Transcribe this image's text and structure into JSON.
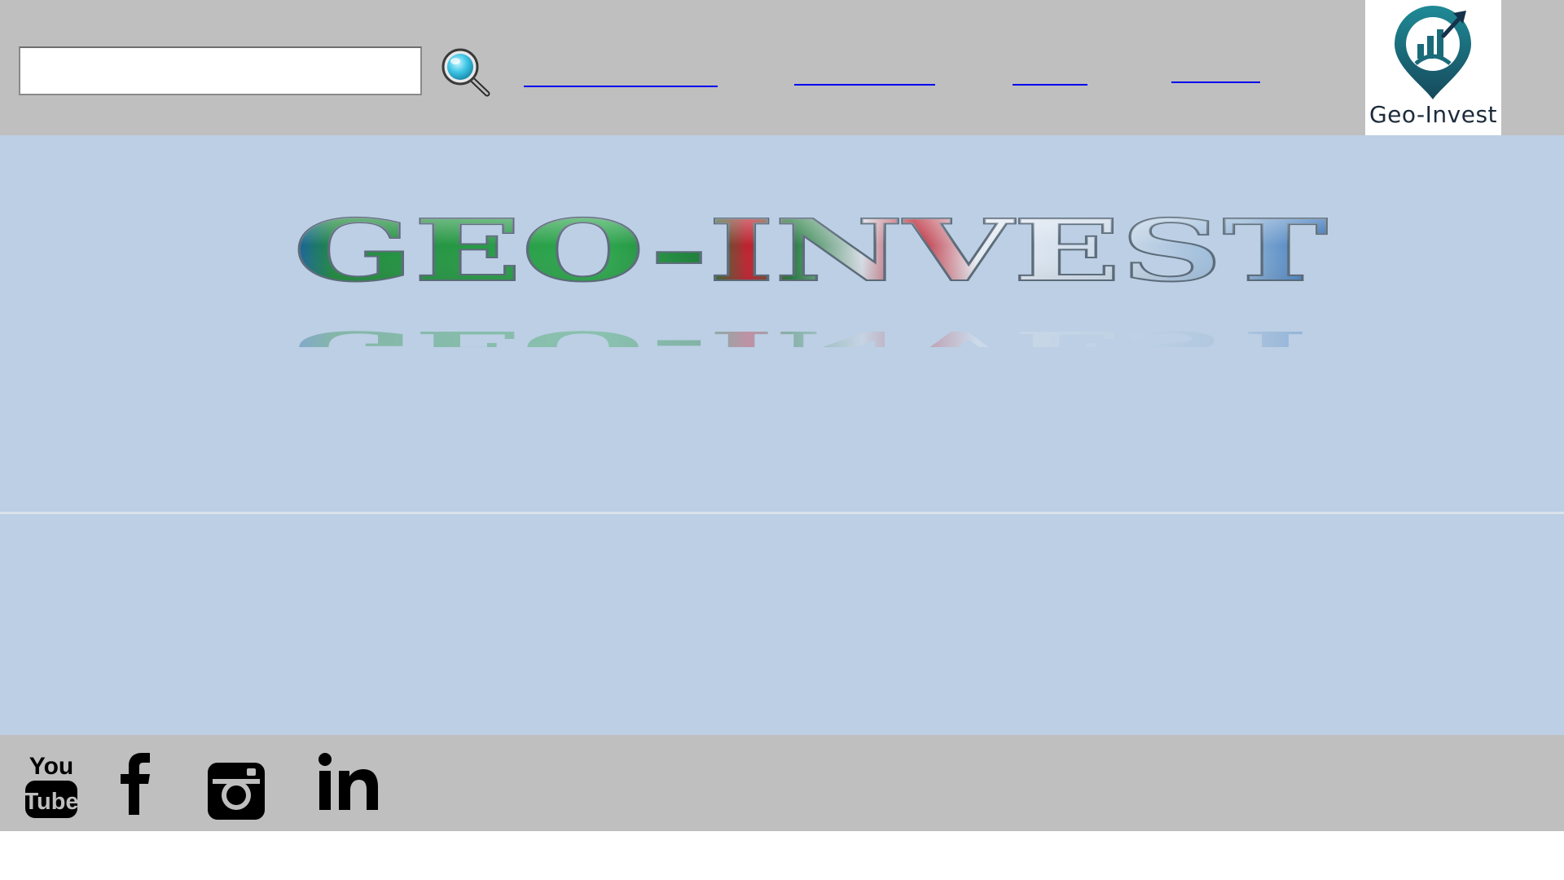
{
  "search": {
    "placeholder": "",
    "value": ""
  },
  "header": {
    "nav_links": [
      "",
      "",
      "",
      ""
    ],
    "logo_text": "Geo-Invest"
  },
  "hero": {
    "wordmark": "GEO-INVEST"
  },
  "footer": {
    "youtube_top": "You",
    "youtube_bottom": "Tube",
    "linkedin": "in"
  },
  "colors": {
    "header_bg": "#bfbfbf",
    "hero_bg": "#bccfe4",
    "link": "#0000ee",
    "logo_teal": "#1a6b7a"
  }
}
